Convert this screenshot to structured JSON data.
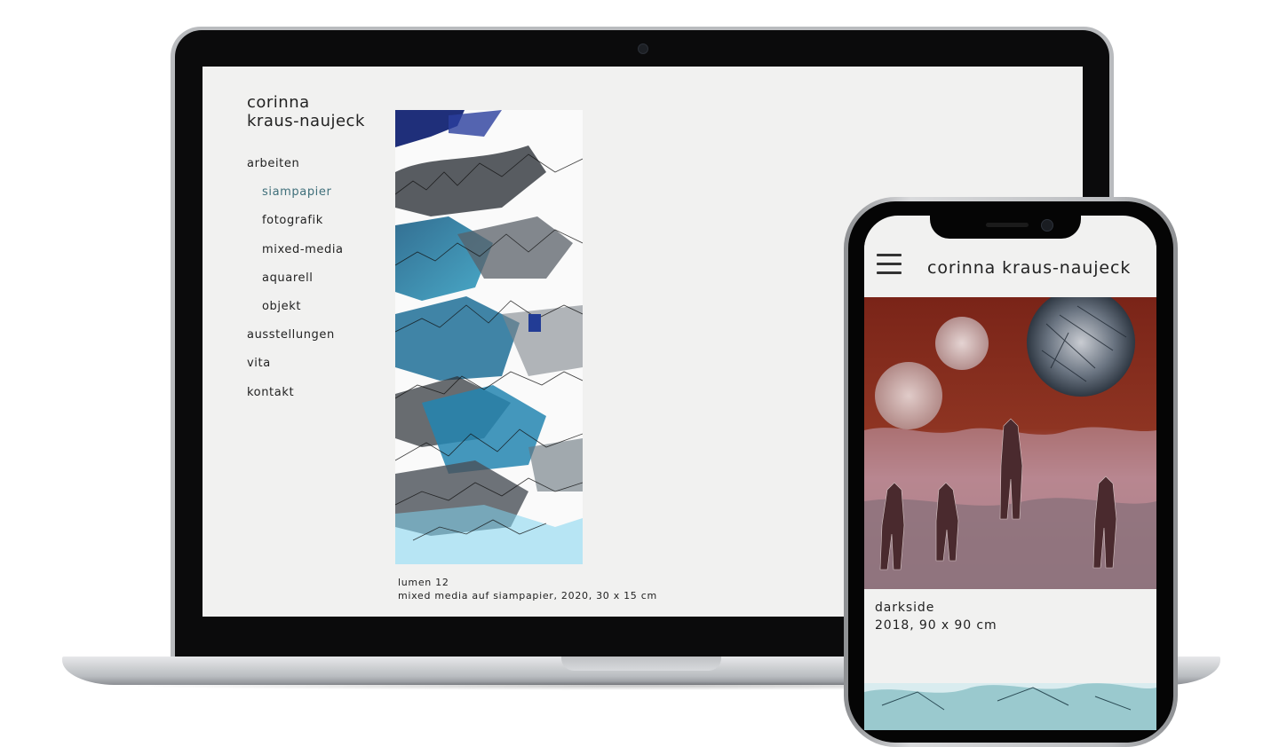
{
  "colors": {
    "page_background": "#f1f1f0",
    "active_nav": "#3f6f7a",
    "text": "#222222"
  },
  "desktop": {
    "site_name": "corinna\nkraus-naujeck",
    "nav": [
      {
        "label": "arbeiten",
        "level": 0,
        "active": false
      },
      {
        "label": "siampapier",
        "level": 1,
        "active": true
      },
      {
        "label": "fotografik",
        "level": 1,
        "active": false
      },
      {
        "label": "mixed-media",
        "level": 1,
        "active": false
      },
      {
        "label": "aquarell",
        "level": 1,
        "active": false
      },
      {
        "label": "objekt",
        "level": 1,
        "active": false
      },
      {
        "label": "ausstellungen",
        "level": 0,
        "active": false
      },
      {
        "label": "vita",
        "level": 0,
        "active": false
      },
      {
        "label": "kontakt",
        "level": 0,
        "active": false
      }
    ],
    "artwork": {
      "title": "lumen 12",
      "details": "mixed media auf siampapier, 2020, 30 x 15 cm"
    }
  },
  "mobile": {
    "menu_icon": "hamburger-menu-icon",
    "site_name": "corinna kraus-naujeck",
    "artwork": {
      "title": "darkside",
      "details": "2018, 90 x 90 cm"
    }
  }
}
